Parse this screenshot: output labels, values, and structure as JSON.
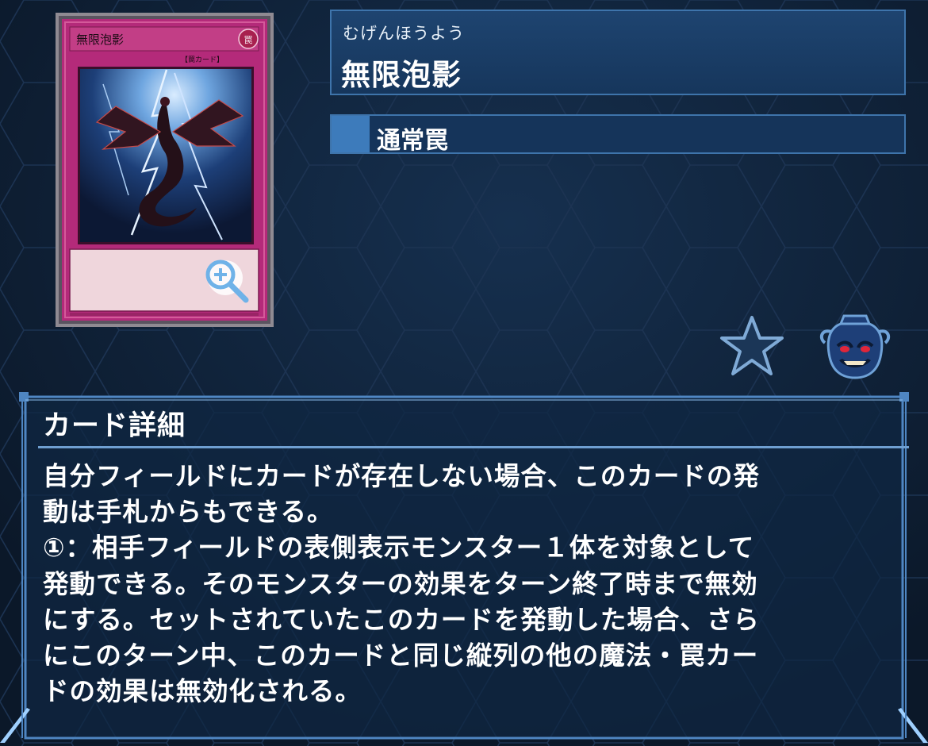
{
  "card": {
    "ruby": "むげんほうよう",
    "name": "無限泡影",
    "type": "通常罠",
    "card_face_name": "無限泡影",
    "card_face_attribute": "罠",
    "card_face_subtype": "【罠カード】"
  },
  "detail": {
    "heading": "カード詳細",
    "text": "自分フィールドにカードが存在しない場合、このカードの発\n動は手札からもできる。\n①：相手フィールドの表側表示モンスター１体を対象として\n発動できる。そのモンスターの効果をターン終了時まで無効\nにする。セットされていたこのカードを発動した場合、さら\nにこのターン中、このカードと同じ縦列の他の魔法・罠カー\nドの効果は無効化される。"
  },
  "icons": {
    "zoom": "magnify-plus-icon",
    "favorite": "star-icon",
    "pot": "pot-of-greed-icon"
  },
  "colors": {
    "background": "#0e1e33",
    "panel": "#1e4470",
    "panel_border": "#3e74ab",
    "accent": "#3d7bbb",
    "trap_card": "#b42a7a"
  }
}
